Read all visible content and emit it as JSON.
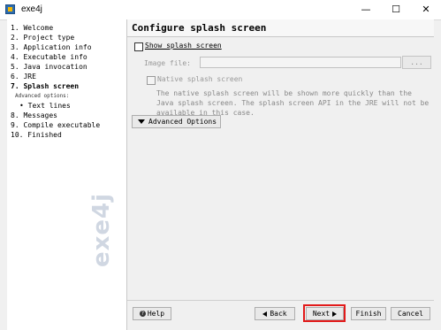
{
  "window": {
    "title": "exe4j",
    "min_icon": "—",
    "max_icon": "☐",
    "close_icon": "✕"
  },
  "sidebar": {
    "steps": [
      {
        "label": "1. Welcome"
      },
      {
        "label": "2. Project type"
      },
      {
        "label": "3. Application info"
      },
      {
        "label": "4. Executable info"
      },
      {
        "label": "5. Java invocation"
      },
      {
        "label": "6. JRE"
      },
      {
        "label": "7. Splash screen"
      },
      {
        "label": "Advanced options:"
      },
      {
        "label": "• Text lines"
      },
      {
        "label": "8. Messages"
      },
      {
        "label": "9. Compile executable"
      },
      {
        "label": "10. Finished"
      }
    ],
    "brand": "exe4j"
  },
  "main": {
    "title": "Configure splash screen",
    "show_splash_label": "Show splash screen",
    "image_file_label": "Image file:",
    "browse_label": "...",
    "native_splash_label": "Native splash screen",
    "description": "The native splash screen will be shown more quickly than the Java splash screen. The splash screen API in the JRE will not be available in this case.",
    "advanced_label": "Advanced Options"
  },
  "footer": {
    "help": "Help",
    "back": "Back",
    "next": "Next",
    "finish": "Finish",
    "cancel": "Cancel"
  },
  "colors": {
    "highlight": "#e21a1a"
  }
}
